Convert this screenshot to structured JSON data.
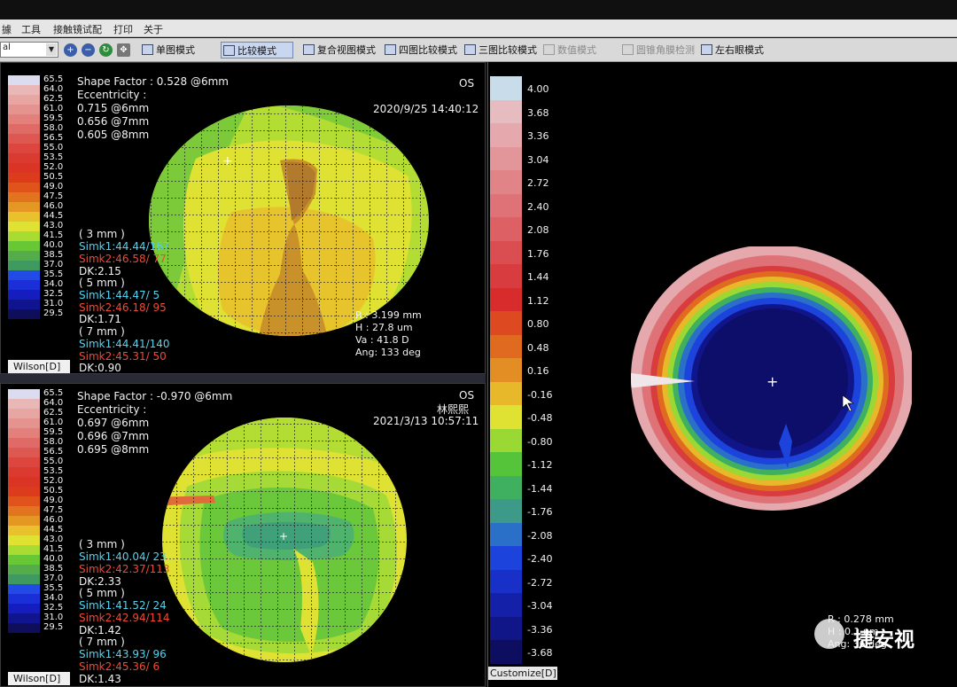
{
  "menu": [
    "據",
    "工具",
    "接触镜试配",
    "打印",
    "关于"
  ],
  "toolbar": {
    "select_value": "al",
    "zoom_in_icon": "zoom-in-icon",
    "zoom_out_icon": "zoom-out-icon",
    "refresh_icon": "refresh-icon",
    "buttons": [
      {
        "label": "单图模式",
        "state": "normal"
      },
      {
        "label": "比较模式",
        "state": "active"
      },
      {
        "label": "复合视图模式",
        "state": "normal"
      },
      {
        "label": "四图比较模式",
        "state": "normal"
      },
      {
        "label": "三图比较模式",
        "state": "normal"
      },
      {
        "label": "数值模式",
        "state": "disabled"
      },
      {
        "label": "圆锥角膜检测",
        "state": "disabled"
      },
      {
        "label": "左右眼模式",
        "state": "normal"
      }
    ]
  },
  "scale": {
    "values": [
      "65.5",
      "64.0",
      "62.5",
      "61.0",
      "59.5",
      "58.0",
      "56.5",
      "55.0",
      "53.5",
      "52.0",
      "50.5",
      "49.0",
      "47.5",
      "46.0",
      "44.5",
      "43.0",
      "41.5",
      "40.0",
      "38.5",
      "37.0",
      "35.5",
      "34.0",
      "32.5",
      "31.0",
      "29.5"
    ],
    "colors": [
      "#dcdcf0",
      "#e9b8b6",
      "#e7a6a2",
      "#e4938e",
      "#e3807b",
      "#e06b66",
      "#de5852",
      "#dc463f",
      "#da3a2f",
      "#d93424",
      "#dc3c1c",
      "#e0541c",
      "#e3741f",
      "#e59724",
      "#e8c12c",
      "#dfe232",
      "#a9dc33",
      "#68c735",
      "#55ac4a",
      "#3f9a5f",
      "#214be4",
      "#1b2fd8",
      "#151dbe",
      "#10158f",
      "#0e0e5a"
    ],
    "footer": "Wilson[D]"
  },
  "top": {
    "shape_factor": "Shape Factor : 0.528 @6mm",
    "eccentricity_label": "Eccentricity :",
    "ecc": [
      "0.715 @6mm",
      "0.656 @7mm",
      "0.605 @8mm"
    ],
    "eye": "OS",
    "date": "2020/9/25 14:40:12",
    "zones": [
      {
        "label": "( 3 mm )",
        "simk1": "Simk1:44.44/167",
        "simk2": "Simk2:46.58/ 77",
        "dk": "DK:2.15"
      },
      {
        "label": "( 5 mm )",
        "simk1": "Simk1:44.47/  5",
        "simk2": "Simk2:46.18/ 95",
        "dk": "DK:1.71"
      },
      {
        "label": "( 7 mm )",
        "simk1": "Simk1:44.41/140",
        "simk2": "Simk2:45.31/ 50",
        "dk": "DK:0.90"
      }
    ],
    "measure": {
      "r": "R  :  3.199 mm",
      "h": "H  :  27.8 um",
      "va": "Va  :  41.8 D",
      "ang": "Ang:  133 deg"
    }
  },
  "bottom": {
    "shape_factor": "Shape Factor : -0.970 @6mm",
    "eccentricity_label": "Eccentricity :",
    "ecc": [
      "0.697 @6mm",
      "0.696 @7mm",
      "0.695 @8mm"
    ],
    "eye": "OS",
    "patient": "林熙熙",
    "date": "2021/3/13 10:57:11",
    "zones": [
      {
        "label": "( 3 mm )",
        "simk1": "Simk1:40.04/ 23",
        "simk2": "Simk2:42.37/113",
        "dk": "DK:2.33"
      },
      {
        "label": "( 5 mm )",
        "simk1": "Simk1:41.52/ 24",
        "simk2": "Simk2:42.94/114",
        "dk": "DK:1.42"
      },
      {
        "label": "( 7 mm )",
        "simk1": "Simk1:43.93/ 96",
        "simk2": "Simk2:45.36/  6",
        "dk": "DK:1.43"
      }
    ]
  },
  "right": {
    "scale_values": [
      "4.00",
      "3.68",
      "3.36",
      "3.04",
      "2.72",
      "2.40",
      "2.08",
      "1.76",
      "1.44",
      "1.12",
      "0.80",
      "0.48",
      "0.16",
      "-0.16",
      "-0.48",
      "-0.80",
      "-1.12",
      "-1.44",
      "-1.76",
      "-2.08",
      "-2.40",
      "-2.72",
      "-3.04",
      "-3.36",
      "-3.68"
    ],
    "scale_colors": [
      "#c9dcea",
      "#e6bcc0",
      "#e4a8ad",
      "#e2969a",
      "#e08488",
      "#de7276",
      "#dc6064",
      "#da4e52",
      "#d83c3f",
      "#d82c2c",
      "#dd4a22",
      "#e06a20",
      "#e38e24",
      "#e6b82a",
      "#dfe232",
      "#9ad834",
      "#56c43a",
      "#3fb060",
      "#3e9a88",
      "#2a70c8",
      "#1c44dc",
      "#1830c8",
      "#1420a8",
      "#101688",
      "#0e0e60"
    ],
    "footer": "Customize[D]",
    "measure": {
      "r": "R  :  0.278 mm",
      "h": "H  :  0.1 um",
      "ang": "Ang:  36 deg"
    },
    "watermark": "捷安视"
  }
}
